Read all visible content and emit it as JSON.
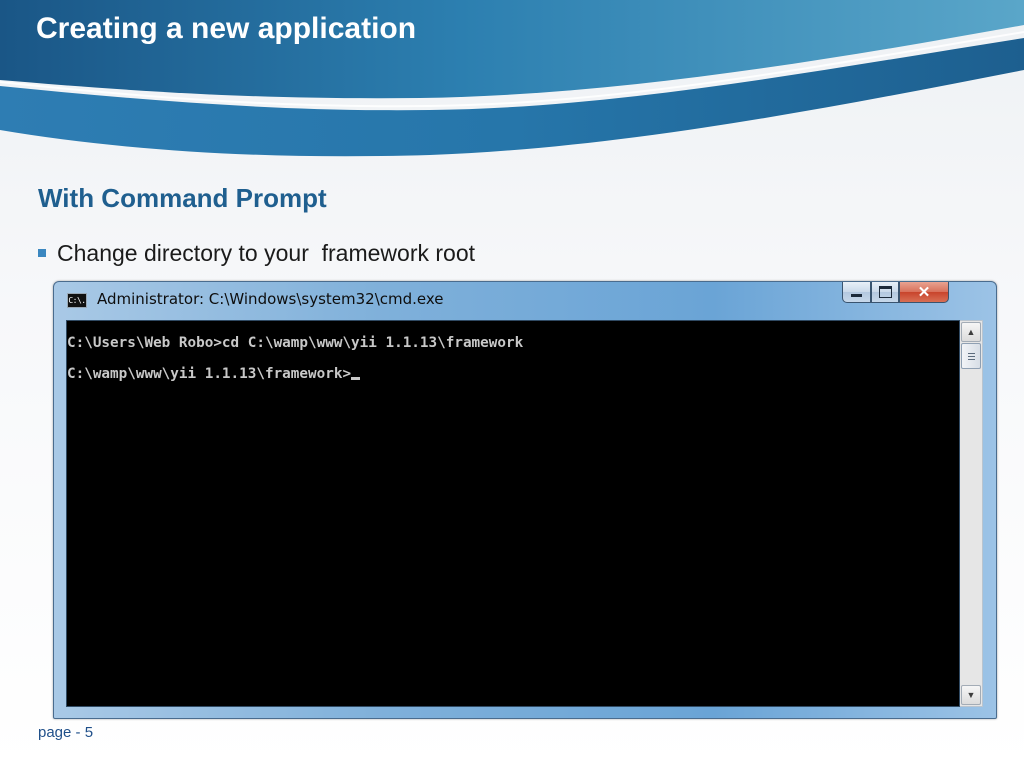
{
  "slide": {
    "title": "Creating a new application",
    "subtitle": "With Command Prompt",
    "bullets": [
      "Change directory to your  framework root"
    ],
    "page_label": "page - 5"
  },
  "window": {
    "title": "Administrator: C:\\Windows\\system32\\cmd.exe",
    "icon_text": "C:\\.",
    "controls": {
      "minimize": "minimize-icon",
      "maximize": "maximize-icon",
      "close": "close-icon",
      "close_glyph": "✕"
    }
  },
  "console": {
    "lines": [
      "C:\\Users\\Web Robo>cd C:\\wamp\\www\\yii 1.1.13\\framework",
      "C:\\wamp\\www\\yii 1.1.13\\framework>"
    ]
  },
  "scrollbar": {
    "up_glyph": "▲",
    "down_glyph": "▼"
  },
  "colors": {
    "banner": "#1e5f8e",
    "subtitle": "#1f5f8f",
    "close_button": "#c8442c",
    "console_bg": "#000000"
  }
}
